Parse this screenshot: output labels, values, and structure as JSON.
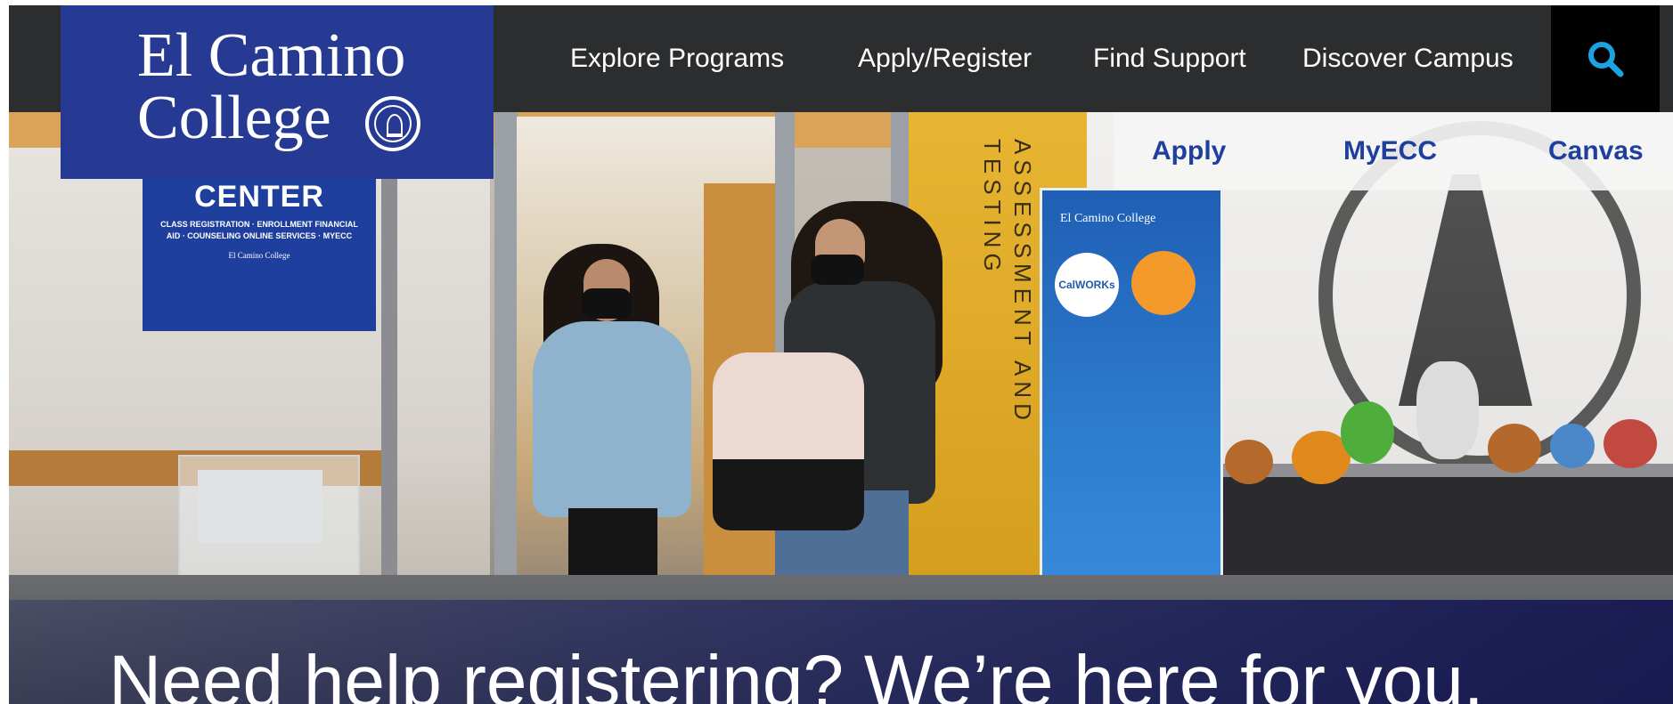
{
  "logo": {
    "line1": "El Camino",
    "line2": "College"
  },
  "nav": {
    "items": [
      {
        "label": "Explore Programs"
      },
      {
        "label": "Apply/Register"
      },
      {
        "label": "Find Support"
      },
      {
        "label": "Discover Campus"
      }
    ],
    "search_icon": "search-icon"
  },
  "quick_links": [
    {
      "label": "Apply"
    },
    {
      "label": "MyECC"
    },
    {
      "label": "Canvas"
    }
  ],
  "hero": {
    "headline": "Need help registering? We’re here for you.",
    "photo_text": {
      "welcome_sign": "WELCOME CENTER",
      "welcome_sign_sub": "CLASS REGISTRATION · ENROLLMENT FINANCIAL AID · COUNSELING ONLINE SERVICES · MYECC",
      "welcome_sign_footer": "El Camino College",
      "wall_text": "ASSESSMENT AND TESTING",
      "banner_title": "El Camino College",
      "banner_badge": "CalWORKs"
    }
  },
  "colors": {
    "topbar": "#2b2d2f",
    "logo_bg": "#263a93",
    "search_icon": "#1aa3e0",
    "quick_link": "#1f3f9e"
  }
}
